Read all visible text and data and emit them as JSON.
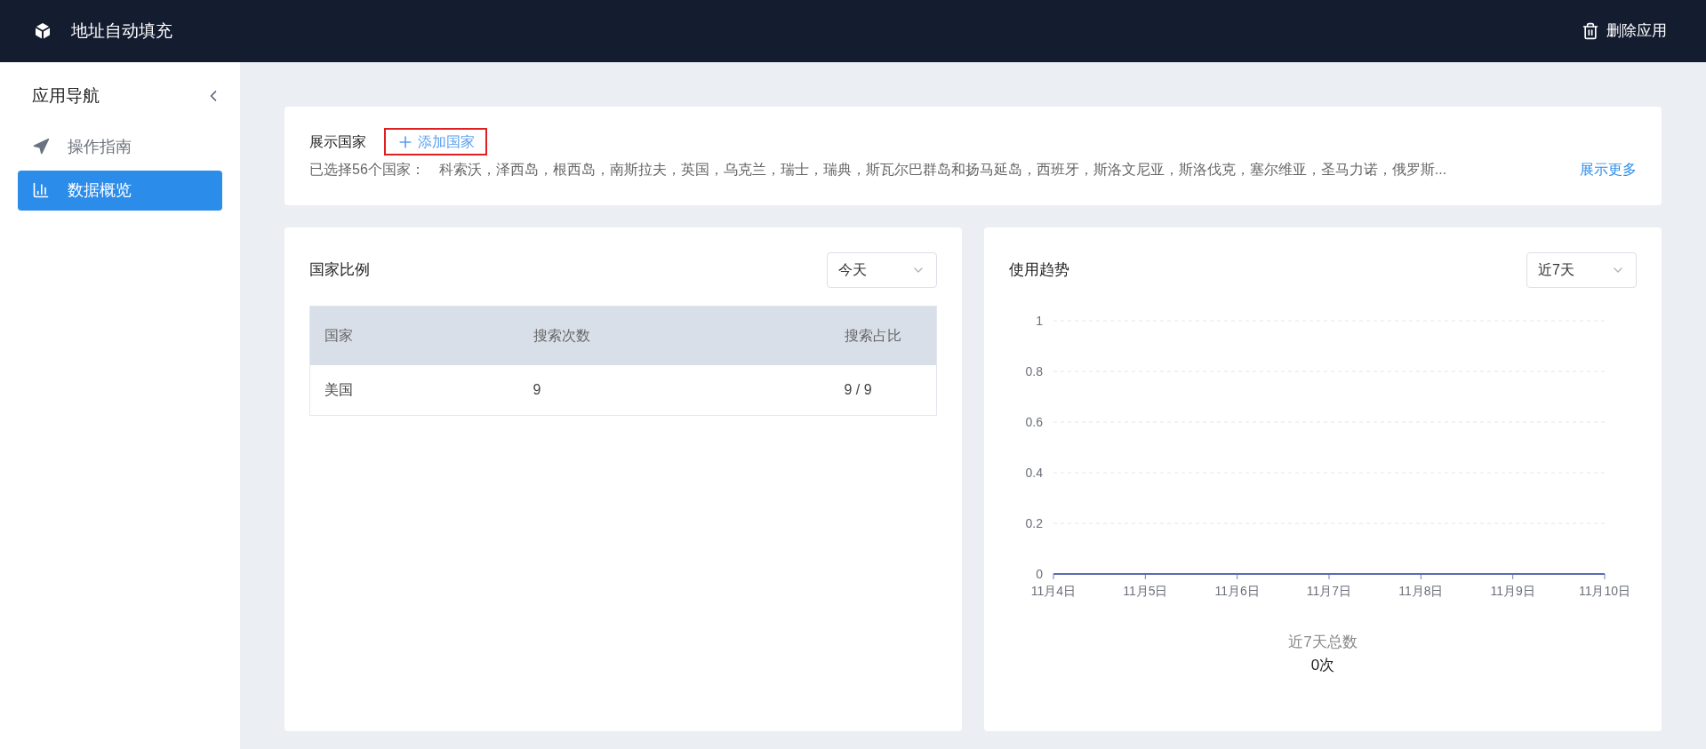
{
  "header": {
    "title": "地址自动填充",
    "action": "删除应用"
  },
  "sidebar": {
    "title": "应用导航",
    "items": [
      {
        "label": "操作指南",
        "kind": "guide",
        "selected": false
      },
      {
        "label": "数据概览",
        "kind": "chart",
        "selected": true
      }
    ]
  },
  "countries_card": {
    "title": "展示国家",
    "add_button": "添加国家",
    "selected_label": "已选择56个国家：",
    "selected_list": "科索沃，泽西岛，根西岛，南斯拉夫，英国，乌克兰，瑞士，瑞典，斯瓦尔巴群岛和扬马延岛，西班牙，斯洛文尼亚，斯洛伐克，塞尔维亚，圣马力诺，俄罗斯...",
    "more_link": "展示更多"
  },
  "ratio_card": {
    "title": "国家比例",
    "period": "今天",
    "table": {
      "columns": [
        "国家",
        "搜索次数",
        "搜索占比"
      ],
      "rows": [
        [
          "美国",
          "9",
          "9 / 9"
        ]
      ]
    }
  },
  "trend_card": {
    "title": "使用趋势",
    "period": "近7天",
    "chart_data": {
      "type": "line",
      "categories": [
        "11月4日",
        "11月5日",
        "11月6日",
        "11月7日",
        "11月8日",
        "11月9日",
        "11月10日"
      ],
      "values": [
        0,
        0,
        0,
        0,
        0,
        0,
        0
      ],
      "grid": true,
      "ylim": [
        0,
        1
      ],
      "yticks": [
        0,
        0.2,
        0.4,
        0.6,
        0.8,
        1
      ]
    },
    "total_label": "近7天总数",
    "total_value": "0次"
  }
}
